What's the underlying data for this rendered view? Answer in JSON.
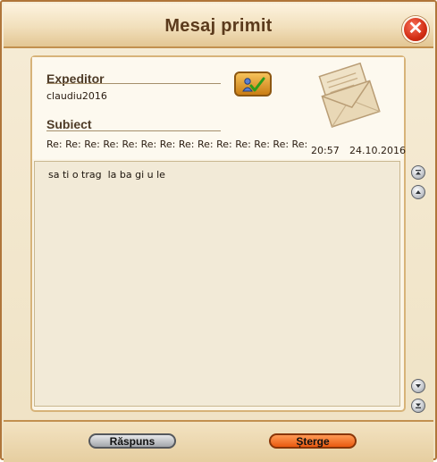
{
  "window": {
    "title": "Mesaj primit",
    "close_label": "✕"
  },
  "message": {
    "sender_label": "Expeditor",
    "sender": "claudiu2016",
    "subject_label": "Subiect",
    "subject": "Re: Re: Re: Re: Re: Re: Re: Re: Re: Re: Re: Re: Re: Re:",
    "time": "20:57",
    "date": "24.10.2016",
    "body": "sa ti o trag  la ba gi u le"
  },
  "icons": {
    "close": "close-icon",
    "contact": "add-contact-icon",
    "envelope": "envelope-icon",
    "scroll_top": "scroll-top-icon",
    "scroll_up": "scroll-up-icon",
    "scroll_down": "scroll-down-icon",
    "scroll_bottom": "scroll-bottom-icon"
  },
  "footer": {
    "reply_label": "Răspuns",
    "delete_label": "Șterge"
  },
  "colors": {
    "title_text": "#5b3a1c",
    "close_button": "#d22d14",
    "delete_button": "#e95a10",
    "reply_button": "#a3a6ab",
    "frame": "#b0763a"
  }
}
